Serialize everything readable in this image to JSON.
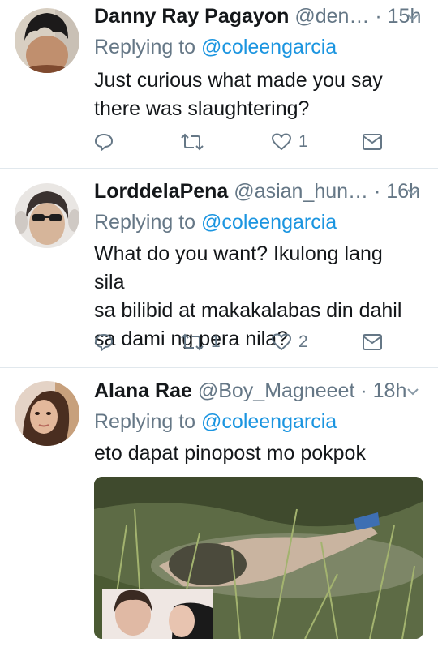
{
  "tweets": [
    {
      "name": "Danny Ray Pagayon",
      "handle": "@den…",
      "time": "· 15h",
      "replying_label": "Replying to",
      "replying_to": "@coleengarcia",
      "text_lines": [
        "Just curious what made you say",
        "there was slaughtering?"
      ],
      "retweets": "",
      "likes": "1"
    },
    {
      "name": "LorddelaPena",
      "handle": "@asian_hun…",
      "time": "· 16h",
      "replying_label": "Replying to",
      "replying_to": "@coleengarcia",
      "text_lines": [
        "What do you want? Ikulong lang sila",
        "sa bilibid at makakalabas din dahil",
        "sa dami ng pera nila?"
      ],
      "retweets": "1",
      "likes": "2"
    },
    {
      "name": "Alana Rae",
      "handle": "@Boy_Magneeet",
      "time": "· 18h",
      "replying_label": "Replying to",
      "replying_to": "@coleengarcia",
      "text_lines": [
        "eto dapat pinopost mo pokpok"
      ],
      "has_media": true
    }
  ],
  "icons": {
    "reply": "reply-icon",
    "retweet": "retweet-icon",
    "like": "heart-icon",
    "dm": "envelope-icon",
    "more": "chevron-down-icon"
  },
  "colors": {
    "link": "#1b95e0",
    "muted": "#657786",
    "text": "#14171a",
    "divider": "#e1e8ed"
  }
}
